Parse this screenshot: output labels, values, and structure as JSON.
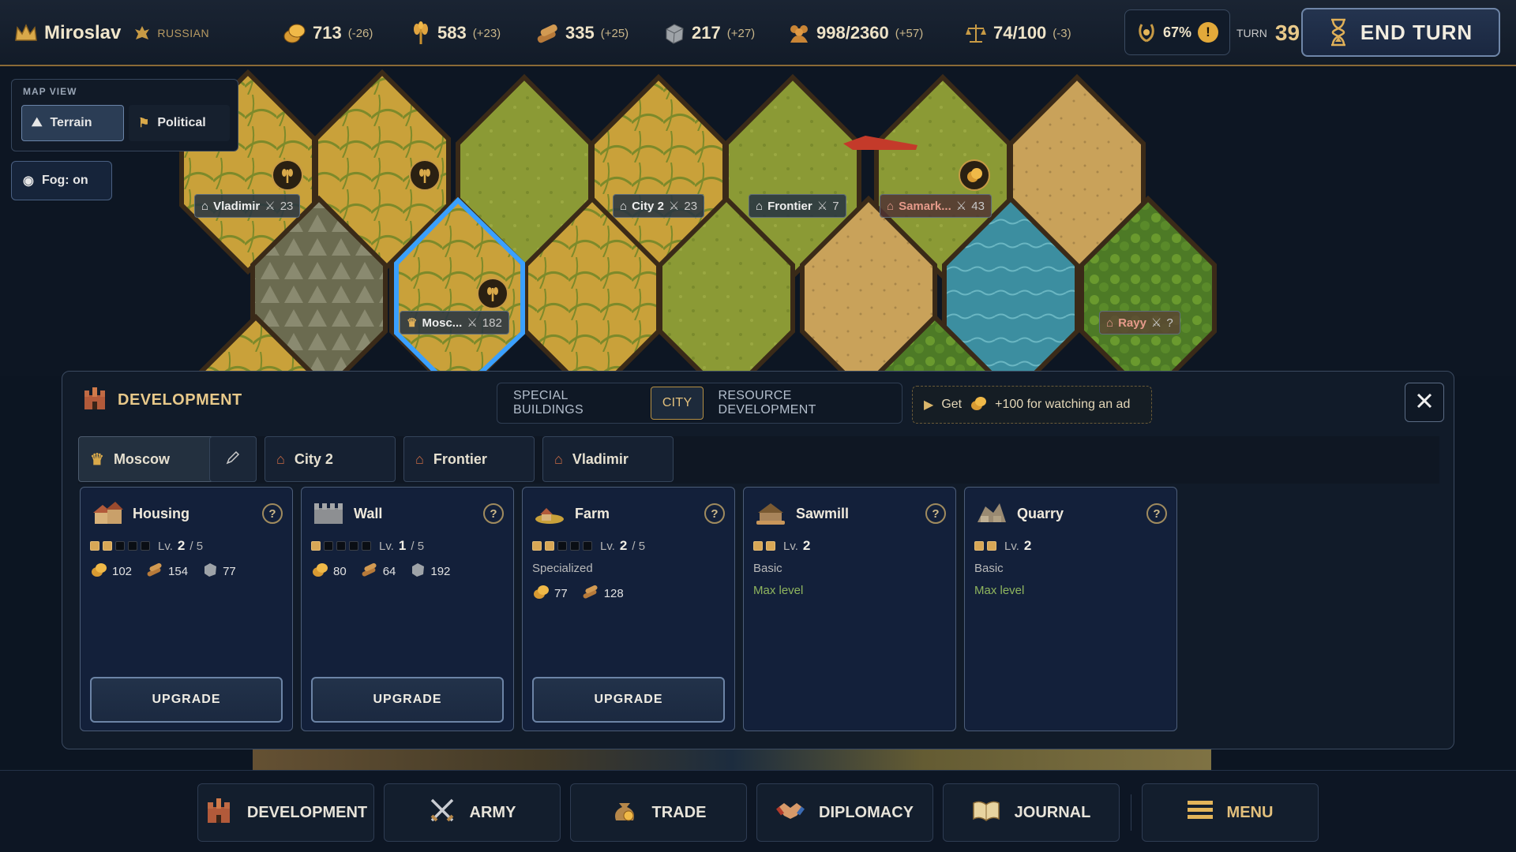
{
  "topbar": {
    "player_name": "Miroslav",
    "nation": "RUSSIAN",
    "resources": [
      {
        "icon": "gold-coins-icon",
        "value": "713",
        "delta": "(-26)"
      },
      {
        "icon": "grain-icon",
        "value": "583",
        "delta": "(+23)"
      },
      {
        "icon": "wood-logs-icon",
        "value": "335",
        "delta": "(+25)"
      },
      {
        "icon": "stone-block-icon",
        "value": "217",
        "delta": "(+27)"
      },
      {
        "icon": "population-icon",
        "value": "998/2360",
        "delta": "(+57)"
      },
      {
        "icon": "scales-icon",
        "value": "74/100",
        "delta": "(-3)"
      }
    ],
    "approval": "67%",
    "approval_alert": "!",
    "turn_label": "TURN",
    "turn_number": "39",
    "end_turn_label": "END TURN"
  },
  "map": {
    "map_view_title": "MAP VIEW",
    "terrain_label": "Terrain",
    "political_label": "Political",
    "fog_label": "Fog: on",
    "cities": [
      {
        "name": "Vladimir",
        "strength": "23"
      },
      {
        "name": "City 2",
        "strength": "23"
      },
      {
        "name": "Frontier",
        "strength": "7"
      },
      {
        "name": "Samark...",
        "strength": "43"
      },
      {
        "name": "Mosc...",
        "strength": "182"
      },
      {
        "name": "Rayy",
        "strength": "?"
      }
    ]
  },
  "development": {
    "title": "DEVELOPMENT",
    "tabs": [
      "SPECIAL BUILDINGS",
      "CITY",
      "RESOURCE DEVELOPMENT"
    ],
    "active_tab": "CITY",
    "ad_get": "Get",
    "ad_text": "+100 for watching an ad",
    "city_tabs": [
      "Moscow",
      "City 2",
      "Frontier",
      "Vladimir"
    ],
    "buildings": [
      {
        "name": "Housing",
        "level": "2",
        "max": "/ 5",
        "pips": 5,
        "filled": 2,
        "costs": [
          "102",
          "154",
          "77"
        ],
        "button": "UPGRADE"
      },
      {
        "name": "Wall",
        "level": "1",
        "max": "/ 5",
        "pips": 5,
        "filled": 1,
        "costs": [
          "80",
          "64",
          "192"
        ],
        "button": "UPGRADE"
      },
      {
        "name": "Farm",
        "level": "2",
        "max": "/ 5",
        "pips": 5,
        "filled": 2,
        "subtitle": "Specialized",
        "costs": [
          "77",
          "128"
        ],
        "button": "UPGRADE"
      },
      {
        "name": "Sawmill",
        "level": "2",
        "pips": 2,
        "filled": 2,
        "subtitle": "Basic",
        "status": "Max level"
      },
      {
        "name": "Quarry",
        "level": "2",
        "pips": 2,
        "filled": 2,
        "subtitle": "Basic",
        "status": "Max level"
      }
    ],
    "level_prefix": "Lv."
  },
  "nav": [
    "DEVELOPMENT",
    "ARMY",
    "TRADE",
    "DIPLOMACY",
    "JOURNAL",
    "MENU"
  ],
  "colors": {
    "accent_gold": "#e3c07c",
    "panel_bg": "#111b29",
    "button_border": "#6c84a6",
    "max_level_green": "#8fb55e"
  }
}
